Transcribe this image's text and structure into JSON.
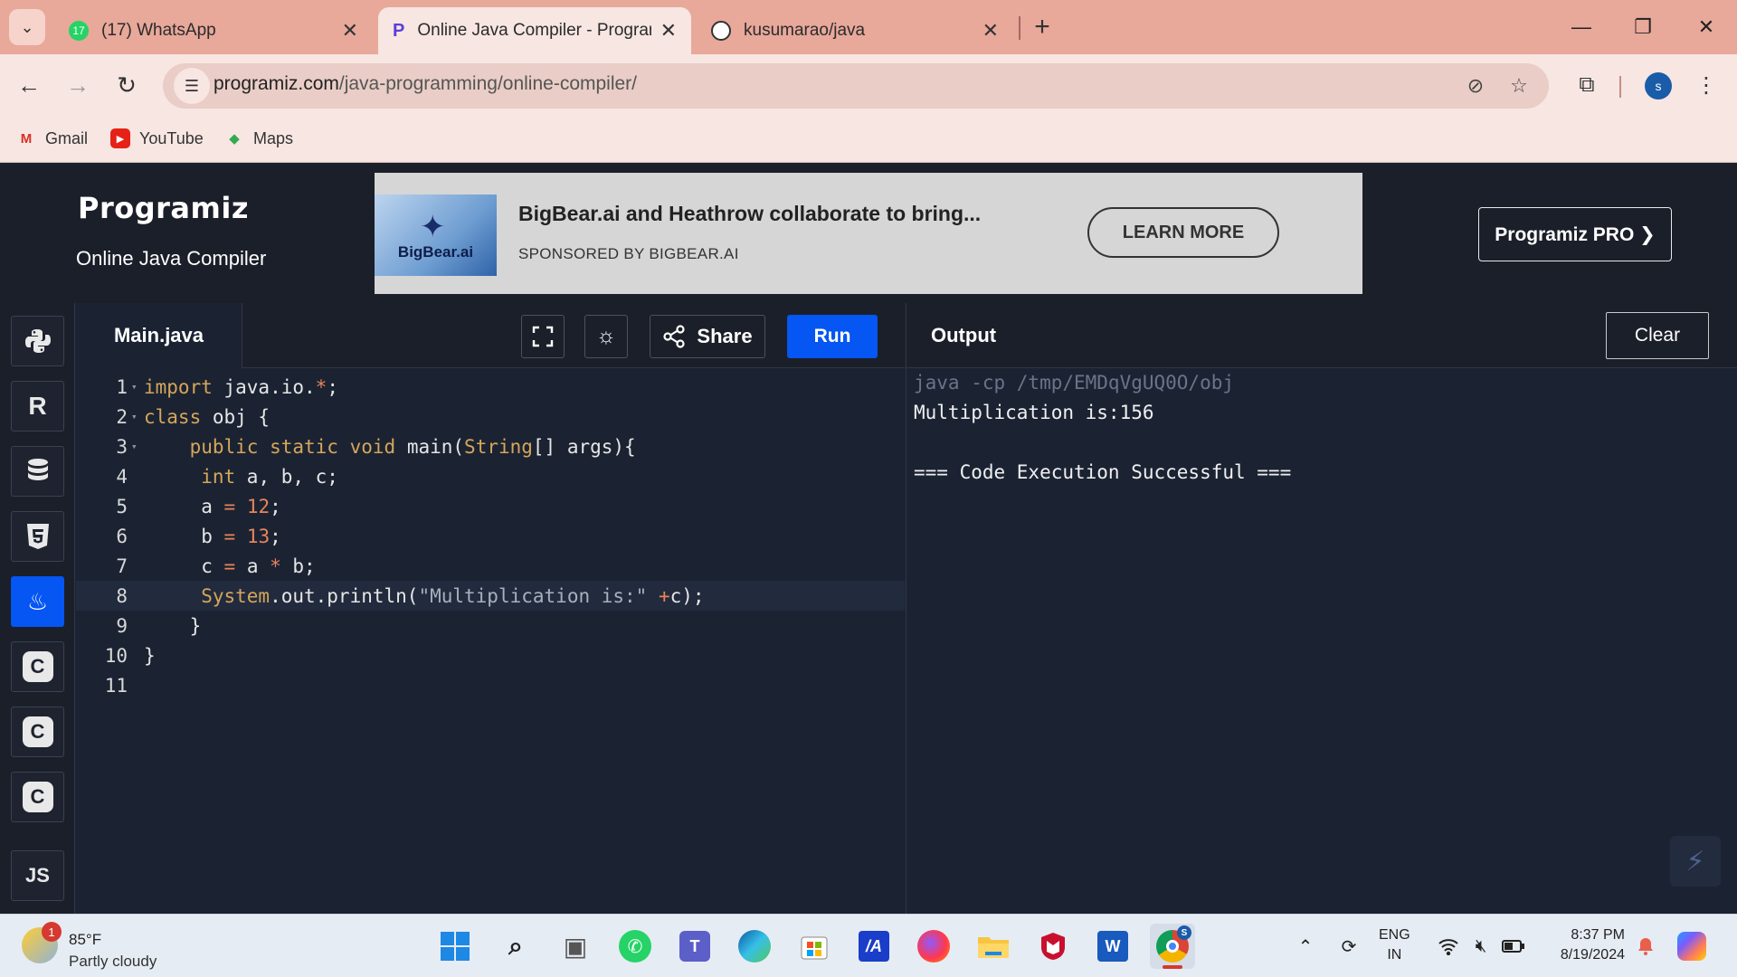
{
  "browser": {
    "tabs": [
      {
        "title": "(17) WhatsApp",
        "icon": "whatsapp-icon"
      },
      {
        "title": "Online Java Compiler - Programiz",
        "icon": "programiz-icon"
      },
      {
        "title": "kusumarao/java",
        "icon": "github-icon"
      }
    ],
    "url_host": "programiz.com",
    "url_path": "/java-programming/online-compiler/",
    "profile_initial": "s",
    "bookmarks": [
      "Gmail",
      "YouTube",
      "Maps"
    ]
  },
  "site": {
    "logo": "Programiz",
    "subtitle": "Online Java Compiler",
    "pro_button": "Programiz PRO ❯"
  },
  "ad": {
    "image_text": "BigBear.ai",
    "title": "BigBear.ai and Heathrow collaborate to bring...",
    "sponsor": "SPONSORED BY BIGBEAR.AI",
    "cta": "LEARN MORE"
  },
  "sidebar": {
    "languages": [
      {
        "name": "python",
        "label": "",
        "active": false
      },
      {
        "name": "r",
        "label": "R",
        "active": false
      },
      {
        "name": "sql",
        "label": "",
        "active": false
      },
      {
        "name": "html",
        "label": "5",
        "active": false
      },
      {
        "name": "java",
        "label": "",
        "active": true
      },
      {
        "name": "c",
        "label": "C",
        "active": false
      },
      {
        "name": "cpp",
        "label": "C",
        "active": false
      },
      {
        "name": "csharp",
        "label": "C",
        "active": false
      },
      {
        "name": "js",
        "label": "JS",
        "active": false
      }
    ]
  },
  "editor": {
    "file_name": "Main.java",
    "share_label": "Share",
    "run_label": "Run",
    "active_line": 8,
    "lines": [
      "import java.io.*;",
      "class obj {",
      "    public static void main(String[] args){",
      "     int a, b, c;",
      "     a = 12;",
      "     b = 13;",
      "     c = a * b;",
      "     System.out.println(\"Multiplication is:\" +c);",
      "    }",
      "}",
      ""
    ]
  },
  "output": {
    "title": "Output",
    "clear_label": "Clear",
    "lines": [
      "java -cp /tmp/EMDqVgUQ0O/obj",
      "Multiplication is:156",
      "",
      "=== Code Execution Successful ==="
    ]
  },
  "taskbar": {
    "weather_temp": "85°F",
    "weather_badge": "1",
    "weather_condition": "Partly cloudy",
    "language_line1": "ENG",
    "language_line2": "IN",
    "time": "8:37 PM",
    "date": "8/19/2024",
    "chrome_badge": "S"
  }
}
